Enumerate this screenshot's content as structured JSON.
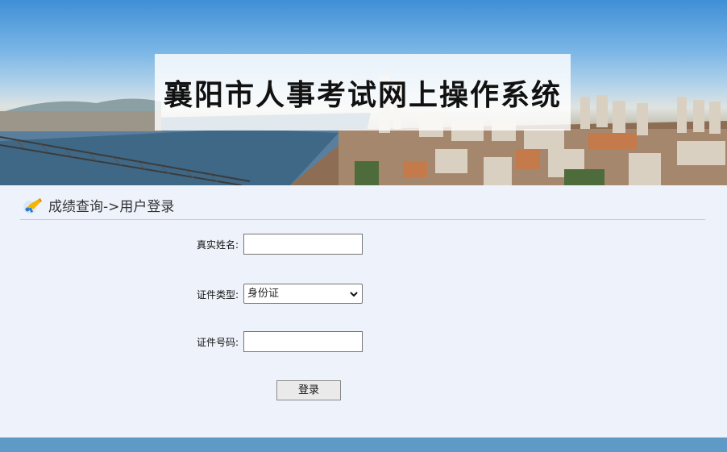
{
  "banner": {
    "title": "襄阳市人事考试网上操作系统"
  },
  "breadcrumb": {
    "text": "成绩查询->用户登录"
  },
  "form": {
    "name_label": "真实姓名:",
    "name_value": "",
    "id_type_label": "证件类型:",
    "id_type_selected": "身份证",
    "id_number_label": "证件号码:",
    "id_number_value": "",
    "login_label": "登录"
  },
  "colors": {
    "page_bg": "#eef3fb",
    "footer": "#5f9ac6"
  }
}
